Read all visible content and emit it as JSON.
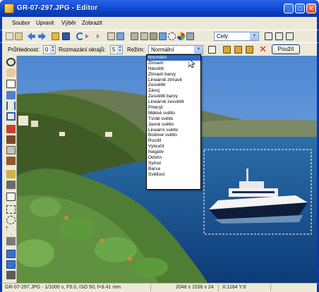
{
  "window": {
    "title": "GR-07-297.JPG - Editor",
    "controls": {
      "minimize": "_",
      "maximize": "□",
      "close": "✕"
    }
  },
  "menu": [
    "Soubor",
    "Upravit",
    "Výběr",
    "Zobrazit"
  ],
  "toolbar1": {
    "zoom_value": "Celý",
    "icons": [
      "copy-icon",
      "paste-icon",
      "back-arrow-icon",
      "forward-arrow-icon",
      "open-icon",
      "save-icon",
      "undo-icon",
      "redo-icon",
      "copy-image-icon",
      "paste-image-icon",
      "rotate-icon",
      "resize-icon",
      "crop-icon",
      "image-icon",
      "effects-icon",
      "color-icon",
      "adjust-icon",
      "fit-icon",
      "fit-width-icon",
      "actual-size-icon"
    ]
  },
  "toolbar2": {
    "opacity_label": "Průhlednost:",
    "opacity_value": "0",
    "blur_label": "Rozmazání okrajů:",
    "blur_value": "5",
    "mode_label": "Režim:",
    "mode_value": "Normální",
    "apply_label": "Použít"
  },
  "blend_modes": [
    "Normální",
    "Ztmavit",
    "Násobit",
    "Ztmavit barvy",
    "Lineárně ztmavit",
    "Zesvětlit",
    "Závoj",
    "Zesvětlit barvy",
    "Lineárně zesvětlit",
    "Překrýt",
    "Měkké světlo",
    "Tvrdé světlo",
    "Jasné světlo",
    "Lineární světlo",
    "Bodové světlo",
    "Rozdíl",
    "Vyloučit",
    "Negativ",
    "Odstín",
    "Sytost",
    "Barva",
    "Světlost"
  ],
  "selected_blend_mode": "Normální",
  "status": {
    "file_info": "GR-07-297.JPG - 1/1000 s, F5.0, ISO 50, f=9.41 mm",
    "dimensions": "2048 x 1536 x 24",
    "coords": "X:1164  Y:6"
  },
  "colors": {
    "title_blue": "#0a38ac",
    "chrome": "#ece9d8",
    "selection": "#316ac5"
  }
}
